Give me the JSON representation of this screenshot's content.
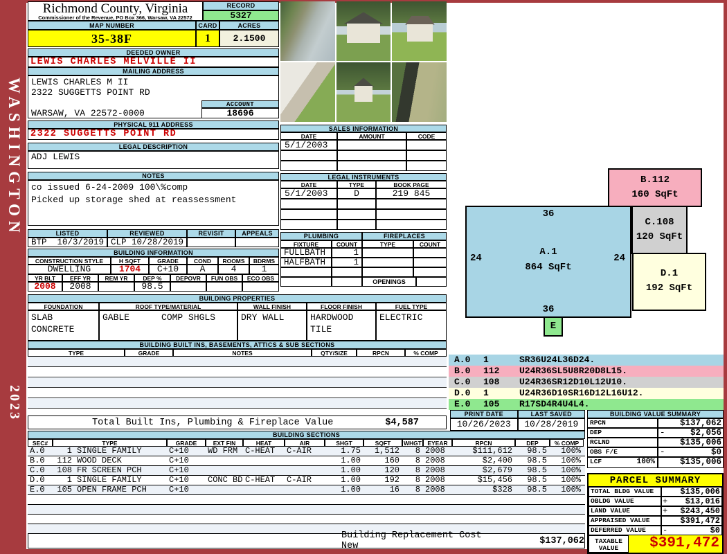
{
  "frame": {
    "district": "WASHINGTON",
    "year": "2023"
  },
  "colors": {
    "frame_red": "#A73B3F",
    "header_blue": "#ACD9E8",
    "highlight_yellow": "#FFFF00",
    "record_green": "#8FE88F",
    "acres_cream": "#F2F1DE",
    "sketch_pink": "#F7AEBE",
    "sketch_gray": "#D0D0D0",
    "sketch_light_yellow": "#FFFFDF",
    "sketch_blue": "#A8D5E5",
    "value_red": "#CC0000"
  },
  "header": {
    "county": "Richmond County, Virginia",
    "commissioner": "Commissioner of the Revenue, PO Box 366, Warsaw, VA 22572",
    "record_label": "RECORD",
    "record": "5327",
    "map_label": "MAP NUMBER",
    "map": "35-38F",
    "card_label": "CARD",
    "card": "1",
    "acres_label": "ACRES",
    "acres": "2.1500"
  },
  "owner": {
    "deeded_label": "DEEDED OWNER",
    "deeded": "LEWIS CHARLES MELVILLE II",
    "mailing_label": "MAILING ADDRESS",
    "mailing_line1": "LEWIS CHARLES M II",
    "mailing_line2": "2322 SUGGETTS POINT RD",
    "mailing_line3": "",
    "mailing_line4": "WARSAW, VA 22572-0000",
    "account_label": "ACCOUNT",
    "account": "18696",
    "physical_label": "PHYSICAL 911 ADDRESS",
    "physical": "2322 SUGGETTS POINT RD",
    "legal_label": "LEGAL DESCRIPTION",
    "legal": "ADJ LEWIS",
    "notes_label": "NOTES",
    "notes_line1": "co issued 6-24-2009 100\\%comp",
    "notes_line2": "Picked up storage shed at reassessment"
  },
  "review": {
    "listed_label": "LISTED",
    "reviewed_label": "REVIEWED",
    "revisit_label": "REVISIT",
    "appeals_label": "APPEALS",
    "listed_code": "BTP",
    "listed_date": "10/3/2019",
    "reviewed_code": "CLP",
    "reviewed_date": "10/28/2019",
    "revisit": "",
    "appeals": ""
  },
  "building_info": {
    "title": "BUILDING INFORMATION",
    "l_style": "CONSTRUCTION STYLE",
    "l_hsqft": "H SQFT",
    "l_grade": "GRADE",
    "l_cond": "COND",
    "l_rooms": "ROOMS",
    "l_bdrms": "BDRMS",
    "v_style": "DWELLING",
    "v_hsqft": "1704",
    "v_grade": "C+10",
    "v_cond": "A",
    "v_rooms": "4",
    "v_bdrms": "1",
    "l_yrblt": "YR BLT",
    "l_effyr": "EFF YR",
    "l_remyr": "REM YR",
    "l_dep": "DEP %",
    "l_depovr": "DEPOVR",
    "l_funobs": "FUN OBS",
    "l_ecoobs": "ECO OBS",
    "v_yrblt": "2008",
    "v_effyr": "2008",
    "v_remyr": "",
    "v_dep": "98.5",
    "v_depovr": "",
    "v_funobs": "",
    "v_ecoobs": ""
  },
  "sales": {
    "title": "SALES INFORMATION",
    "cols": [
      "DATE",
      "AMOUNT",
      "CODE"
    ],
    "rows": [
      [
        "5/1/2003",
        "",
        ""
      ],
      [
        "",
        "",
        ""
      ],
      [
        "",
        "",
        ""
      ]
    ]
  },
  "instruments": {
    "title": "LEGAL INSTRUMENTS",
    "cols": [
      "DATE",
      "TYPE",
      "BOOK PAGE"
    ],
    "rows": [
      [
        "5/1/2003",
        "D",
        "219 845"
      ],
      [
        "",
        "",
        ""
      ],
      [
        "",
        "",
        ""
      ],
      [
        "",
        "",
        ""
      ]
    ]
  },
  "plumbing": {
    "title": "PLUMBING",
    "cols": [
      "FIXTURE",
      "COUNT"
    ],
    "rows": [
      [
        "FULLBATH",
        "1"
      ],
      [
        "HALFBATH",
        "1"
      ],
      [
        "",
        ""
      ],
      [
        "",
        ""
      ]
    ]
  },
  "fireplaces": {
    "title": "FIREPLACES",
    "cols": [
      "TYPE",
      "COUNT"
    ],
    "rows": [
      [
        "",
        ""
      ],
      [
        "",
        ""
      ],
      [
        "",
        ""
      ]
    ],
    "openings_label": "OPENINGS",
    "openings": ""
  },
  "properties": {
    "title": "BUILDING PROPERTIES",
    "l_foundation": "FOUNDATION",
    "l_roof": "ROOF TYPE/MATERIAL",
    "l_wall": "WALL FINISH",
    "l_floor": "FLOOR FINISH",
    "l_fuel": "FUEL TYPE",
    "foundation_1": "SLAB",
    "foundation_2": "CONCRETE",
    "roof_type": "GABLE",
    "roof_material": "COMP SHGLS",
    "wall": "DRY WALL",
    "floor_1": "HARDWOOD",
    "floor_2": "TILE",
    "fuel": "ELECTRIC"
  },
  "builtins": {
    "title": "BUILDING BUILT INS, BASEMENTS, ATTICS & SUB SECTIONS",
    "cols": [
      "TYPE",
      "GRADE",
      "NOTES",
      "QTY/SIZE",
      "RPCN",
      "% COMP"
    ],
    "total_label": "Total Built Ins, Plumbing & Fireplace Value",
    "total": "$4,587"
  },
  "sketch": {
    "a_name": "A.1",
    "a_size": "864 SqFt",
    "a_top": "36",
    "a_bottom": "36",
    "a_left": "24",
    "a_right": "24",
    "b_name": "B.112",
    "b_size": "160 SqFt",
    "c_name": "C.108",
    "c_size": "120 SqFt",
    "d_name": "D.1",
    "d_size": "192 SqFt",
    "e_name": "E"
  },
  "legend": {
    "rows": [
      {
        "sec": "A.0",
        "code": "1",
        "trace": "SR36U24L36D24."
      },
      {
        "sec": "B.0",
        "code": "112",
        "trace": "U24R36SL5U8R20D8L15."
      },
      {
        "sec": "C.0",
        "code": "108",
        "trace": "U24R36SR12D10L12U10."
      },
      {
        "sec": "D.0",
        "code": "1",
        "trace": "U24R36D10SR16D12L16U12."
      },
      {
        "sec": "E.0",
        "code": "105",
        "trace": "R17SD4R4U4L4."
      }
    ]
  },
  "dates": {
    "print_label": "PRINT DATE",
    "print": "10/26/2023",
    "saved_label": "LAST SAVED",
    "saved": "10/28/2019"
  },
  "bvs": {
    "title": "BUILDING VALUE SUMMARY",
    "rows": [
      {
        "label": "RPCN",
        "extra": "",
        "sign": "",
        "value": "$137,062"
      },
      {
        "label": "DEP",
        "extra": "",
        "sign": "-",
        "value": "$2,056"
      },
      {
        "label": "RCLND",
        "extra": "",
        "sign": "",
        "value": "$135,006"
      },
      {
        "label": "OBS F/E",
        "extra": "",
        "sign": "-",
        "value": "$0"
      },
      {
        "label": "LCF",
        "extra": "100%",
        "sign": "",
        "value": "$135,006"
      }
    ]
  },
  "sections": {
    "title": "BUILDING SECTIONS",
    "cols": [
      "SEC#",
      "TYPE",
      "GRADE",
      "EXT FIN",
      "HEAT",
      "AIR",
      "SHGT",
      "SQFT",
      "WHGT",
      "EYEAR",
      "RPCN",
      "DEP",
      "% COMP"
    ],
    "rows": [
      {
        "sec": "A.0",
        "num": "1",
        "type": "SINGLE FAMILY",
        "grade": "C+10",
        "extfin": "WD FRM",
        "heat": "C-HEAT",
        "air": "C-AIR",
        "shgt": "1.75",
        "sqft": "1,512",
        "whgt": "8",
        "eyear": "2008",
        "rpcn": "$111,612",
        "dep": "98.5",
        "comp": "100%"
      },
      {
        "sec": "B.0",
        "num": "112",
        "type": "WOOD DECK",
        "grade": "C+10",
        "extfin": "",
        "heat": "",
        "air": "",
        "shgt": "1.00",
        "sqft": "160",
        "whgt": "8",
        "eyear": "2008",
        "rpcn": "$2,400",
        "dep": "98.5",
        "comp": "100%"
      },
      {
        "sec": "C.0",
        "num": "108",
        "type": "FR SCREEN PCH",
        "grade": "C+10",
        "extfin": "",
        "heat": "",
        "air": "",
        "shgt": "1.00",
        "sqft": "120",
        "whgt": "8",
        "eyear": "2008",
        "rpcn": "$2,679",
        "dep": "98.5",
        "comp": "100%"
      },
      {
        "sec": "D.0",
        "num": "1",
        "type": "SINGLE FAMILY",
        "grade": "C+10",
        "extfin": "CONC BD",
        "heat": "C-HEAT",
        "air": "C-AIR",
        "shgt": "1.00",
        "sqft": "192",
        "whgt": "8",
        "eyear": "2008",
        "rpcn": "$15,456",
        "dep": "98.5",
        "comp": "100%"
      },
      {
        "sec": "E.0",
        "num": "105",
        "type": "OPEN FRAME PCH",
        "grade": "C+10",
        "extfin": "",
        "heat": "",
        "air": "",
        "shgt": "1.00",
        "sqft": "16",
        "whgt": "8",
        "eyear": "2008",
        "rpcn": "$328",
        "dep": "98.5",
        "comp": "100%"
      }
    ],
    "replacement_label": "Building Replacement Cost New",
    "replacement": "$137,062"
  },
  "parcel": {
    "title": "PARCEL SUMMARY",
    "rows": [
      {
        "label": "TOTAL BLDG VALUE",
        "sign": "",
        "value": "$135,006"
      },
      {
        "label": "OBLDG VALUE",
        "sign": "+",
        "value": "$13,016"
      },
      {
        "label": "LAND VALUE",
        "sign": "+",
        "value": "$243,450"
      },
      {
        "label": "APPRAISED VALUE",
        "sign": "",
        "value": "$391,472"
      },
      {
        "label": "DEFERRED VALUE",
        "sign": "-",
        "value": "$0"
      }
    ],
    "taxable_label_1": "TAXABLE",
    "taxable_label_2": "VALUE",
    "taxable": "$391,472"
  }
}
